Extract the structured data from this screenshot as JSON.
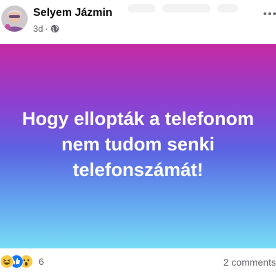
{
  "post": {
    "author": "Selyem Jázmin",
    "time": "3d",
    "separator": "·",
    "audience_icon": "globe-icon",
    "text_lines": [
      "Hogy ellopták a telefonom",
      "nem tudom senki",
      "telefonszámát!"
    ],
    "background_gradient": [
      "#c52aa2",
      "#8f3fd0",
      "#5c63e3",
      "#63a2ef",
      "#78dcf5"
    ]
  },
  "footer": {
    "reaction_icons": [
      "haha-reaction-icon",
      "like-reaction-icon",
      "wow-reaction-icon"
    ],
    "reaction_count": "6",
    "comments": "2 comments"
  },
  "colors": {
    "text_primary": "#050505",
    "text_secondary": "#65676b",
    "like_blue": "#1877f2",
    "reaction_yellow": "#f7c945"
  }
}
